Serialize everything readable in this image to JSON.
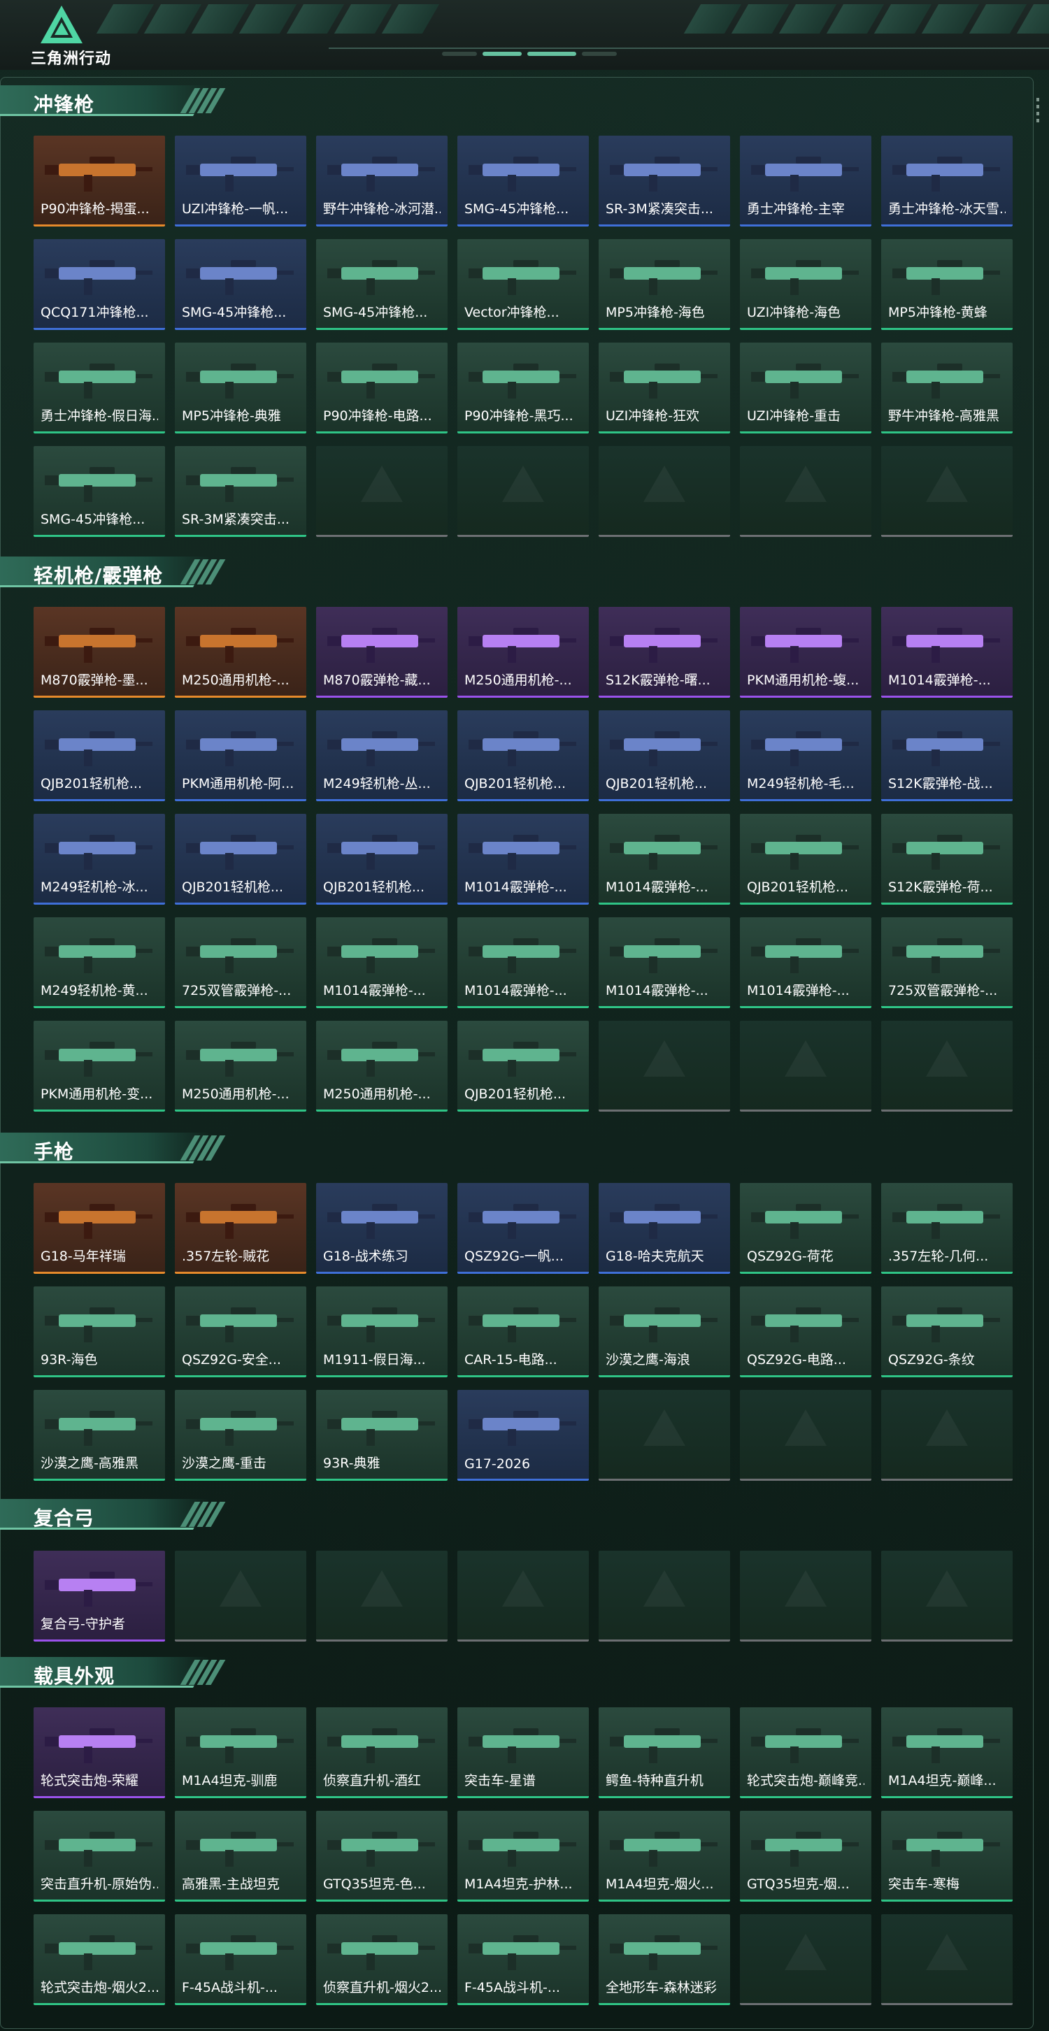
{
  "app": {
    "logo_text": "三角洲行动",
    "accent": "#6fc4a3"
  },
  "sections": [
    {
      "title": "冲锋枪",
      "items": [
        {
          "name": "P90冲锋枪-揭蛋...",
          "rarity": "orange"
        },
        {
          "name": "UZI冲锋枪-一帆...",
          "rarity": "blue"
        },
        {
          "name": "野牛冲锋枪-冰河潜...",
          "rarity": "blue"
        },
        {
          "name": "SMG-45冲锋枪...",
          "rarity": "blue"
        },
        {
          "name": "SR-3M紧凑突击...",
          "rarity": "blue"
        },
        {
          "name": "勇士冲锋枪-主宰",
          "rarity": "blue"
        },
        {
          "name": "勇士冲锋枪-冰天雪...",
          "rarity": "blue"
        },
        {
          "name": "QCQ171冲锋枪...",
          "rarity": "blue"
        },
        {
          "name": "SMG-45冲锋枪...",
          "rarity": "blue"
        },
        {
          "name": "SMG-45冲锋枪...",
          "rarity": "green"
        },
        {
          "name": "Vector冲锋枪...",
          "rarity": "green"
        },
        {
          "name": "MP5冲锋枪-海色",
          "rarity": "green"
        },
        {
          "name": "UZI冲锋枪-海色",
          "rarity": "green"
        },
        {
          "name": "MP5冲锋枪-黄蜂",
          "rarity": "green"
        },
        {
          "name": "勇士冲锋枪-假日海...",
          "rarity": "green"
        },
        {
          "name": "MP5冲锋枪-典雅",
          "rarity": "green"
        },
        {
          "name": "P90冲锋枪-电路...",
          "rarity": "green"
        },
        {
          "name": "P90冲锋枪-黑巧...",
          "rarity": "green"
        },
        {
          "name": "UZI冲锋枪-狂欢",
          "rarity": "green"
        },
        {
          "name": "UZI冲锋枪-重击",
          "rarity": "green"
        },
        {
          "name": "野牛冲锋枪-高雅黑",
          "rarity": "green"
        },
        {
          "name": "SMG-45冲锋枪...",
          "rarity": "green"
        },
        {
          "name": "SR-3M紧凑突击...",
          "rarity": "green"
        },
        {
          "name": "",
          "rarity": "empty"
        },
        {
          "name": "",
          "rarity": "empty"
        },
        {
          "name": "",
          "rarity": "empty"
        },
        {
          "name": "",
          "rarity": "empty"
        },
        {
          "name": "",
          "rarity": "empty"
        }
      ]
    },
    {
      "title": "轻机枪/霰弹枪",
      "items": [
        {
          "name": "M870霰弹枪-墨...",
          "rarity": "orange"
        },
        {
          "name": "M250通用机枪-...",
          "rarity": "orange"
        },
        {
          "name": "M870霰弹枪-藏...",
          "rarity": "purple"
        },
        {
          "name": "M250通用机枪-...",
          "rarity": "purple"
        },
        {
          "name": "S12K霰弹枪-曙...",
          "rarity": "purple"
        },
        {
          "name": "PKM通用机枪-蝮...",
          "rarity": "purple"
        },
        {
          "name": "M1014霰弹枪-...",
          "rarity": "purple"
        },
        {
          "name": "QJB201轻机枪...",
          "rarity": "blue"
        },
        {
          "name": "PKM通用机枪-阿...",
          "rarity": "blue"
        },
        {
          "name": "M249轻机枪-丛...",
          "rarity": "blue"
        },
        {
          "name": "QJB201轻机枪...",
          "rarity": "blue"
        },
        {
          "name": "QJB201轻机枪...",
          "rarity": "blue"
        },
        {
          "name": "M249轻机枪-毛...",
          "rarity": "blue"
        },
        {
          "name": "S12K霰弹枪-战...",
          "rarity": "blue"
        },
        {
          "name": "M249轻机枪-冰...",
          "rarity": "blue"
        },
        {
          "name": "QJB201轻机枪...",
          "rarity": "blue"
        },
        {
          "name": "QJB201轻机枪...",
          "rarity": "blue"
        },
        {
          "name": "M1014霰弹枪-...",
          "rarity": "blue"
        },
        {
          "name": "M1014霰弹枪-...",
          "rarity": "green"
        },
        {
          "name": "QJB201轻机枪...",
          "rarity": "green"
        },
        {
          "name": "S12K霰弹枪-荷...",
          "rarity": "green"
        },
        {
          "name": "M249轻机枪-黄...",
          "rarity": "green"
        },
        {
          "name": "725双管霰弹枪-...",
          "rarity": "green"
        },
        {
          "name": "M1014霰弹枪-...",
          "rarity": "green"
        },
        {
          "name": "M1014霰弹枪-...",
          "rarity": "green"
        },
        {
          "name": "M1014霰弹枪-...",
          "rarity": "green"
        },
        {
          "name": "M1014霰弹枪-...",
          "rarity": "green"
        },
        {
          "name": "725双管霰弹枪-...",
          "rarity": "green"
        },
        {
          "name": "PKM通用机枪-变...",
          "rarity": "green"
        },
        {
          "name": "M250通用机枪-...",
          "rarity": "green"
        },
        {
          "name": "M250通用机枪-...",
          "rarity": "green"
        },
        {
          "name": "QJB201轻机枪...",
          "rarity": "green"
        },
        {
          "name": "",
          "rarity": "empty"
        },
        {
          "name": "",
          "rarity": "empty"
        },
        {
          "name": "",
          "rarity": "empty"
        }
      ]
    },
    {
      "title": "手枪",
      "items": [
        {
          "name": "G18-马年祥瑞",
          "rarity": "orange"
        },
        {
          "name": ".357左轮-贼花",
          "rarity": "orange"
        },
        {
          "name": "G18-战术练习",
          "rarity": "blue"
        },
        {
          "name": "QSZ92G-一帆...",
          "rarity": "blue"
        },
        {
          "name": "G18-哈夫克航天",
          "rarity": "blue"
        },
        {
          "name": "QSZ92G-荷花",
          "rarity": "green"
        },
        {
          "name": ".357左轮-几何...",
          "rarity": "green"
        },
        {
          "name": "93R-海色",
          "rarity": "green"
        },
        {
          "name": "QSZ92G-安全...",
          "rarity": "green"
        },
        {
          "name": "M1911-假日海...",
          "rarity": "green"
        },
        {
          "name": "CAR-15-电路...",
          "rarity": "green"
        },
        {
          "name": "沙漠之鹰-海浪",
          "rarity": "green"
        },
        {
          "name": "QSZ92G-电路...",
          "rarity": "green"
        },
        {
          "name": "QSZ92G-条纹",
          "rarity": "green"
        },
        {
          "name": "沙漠之鹰-高雅黑",
          "rarity": "green"
        },
        {
          "name": "沙漠之鹰-重击",
          "rarity": "green"
        },
        {
          "name": "93R-典雅",
          "rarity": "green"
        },
        {
          "name": "G17-2026",
          "rarity": "blue"
        },
        {
          "name": "",
          "rarity": "empty"
        },
        {
          "name": "",
          "rarity": "empty"
        },
        {
          "name": "",
          "rarity": "empty"
        }
      ]
    },
    {
      "title": "复合弓",
      "items": [
        {
          "name": "复合弓-守护者",
          "rarity": "purple"
        },
        {
          "name": "",
          "rarity": "empty"
        },
        {
          "name": "",
          "rarity": "empty"
        },
        {
          "name": "",
          "rarity": "empty"
        },
        {
          "name": "",
          "rarity": "empty"
        },
        {
          "name": "",
          "rarity": "empty"
        },
        {
          "name": "",
          "rarity": "empty"
        }
      ]
    },
    {
      "title": "载具外观",
      "items": [
        {
          "name": "轮式突击炮-荣耀",
          "rarity": "purple"
        },
        {
          "name": "M1A4坦克-驯鹿",
          "rarity": "green"
        },
        {
          "name": "侦察直升机-酒红",
          "rarity": "green"
        },
        {
          "name": "突击车-星谱",
          "rarity": "green"
        },
        {
          "name": "鳄鱼-特种直升机",
          "rarity": "green"
        },
        {
          "name": "轮式突击炮-巅峰竞...",
          "rarity": "green"
        },
        {
          "name": "M1A4坦克-巅峰...",
          "rarity": "green"
        },
        {
          "name": "突击直升机-原始伪...",
          "rarity": "green"
        },
        {
          "name": "高雅黑-主战坦克",
          "rarity": "green"
        },
        {
          "name": "GTQ35坦克-色...",
          "rarity": "green"
        },
        {
          "name": "M1A4坦克-护林...",
          "rarity": "green"
        },
        {
          "name": "M1A4坦克-烟火...",
          "rarity": "green"
        },
        {
          "name": "GTQ35坦克-烟...",
          "rarity": "green"
        },
        {
          "name": "突击车-寒梅",
          "rarity": "green"
        },
        {
          "name": "轮式突击炮-烟火2...",
          "rarity": "green"
        },
        {
          "name": "F-45A战斗机-...",
          "rarity": "green"
        },
        {
          "name": "侦察直升机-烟火2...",
          "rarity": "green"
        },
        {
          "name": "F-45A战斗机-...",
          "rarity": "green"
        },
        {
          "name": "全地形车-森林迷彩",
          "rarity": "green"
        },
        {
          "name": "",
          "rarity": "empty"
        },
        {
          "name": "",
          "rarity": "empty"
        }
      ]
    }
  ],
  "colors": {
    "orange": "#e68a2b",
    "blue": "#3f6fd8",
    "green": "#2fc486",
    "purple": "#9a52ea",
    "empty": "#6c6f72"
  }
}
